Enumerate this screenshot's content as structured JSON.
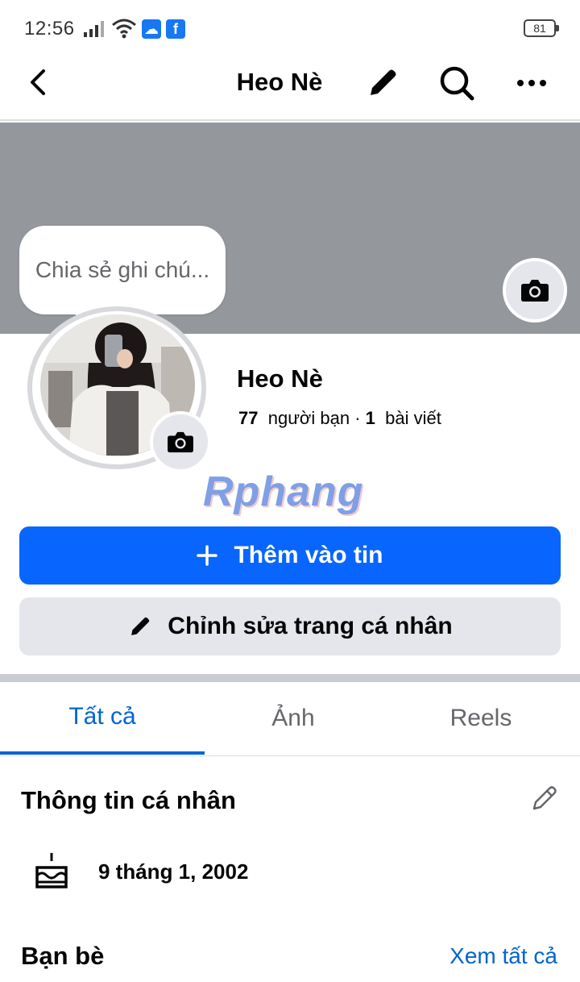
{
  "status_bar": {
    "time": "12:56",
    "battery": "81",
    "icons": [
      "signal-icon",
      "wifi-icon",
      "weather-app-icon",
      "facebook-app-icon"
    ]
  },
  "header": {
    "title": "Heo Nè",
    "icons": [
      "back-arrow-icon",
      "pencil-icon",
      "search-icon",
      "more-dots-icon"
    ]
  },
  "note": {
    "placeholder": "Chia sẻ ghi chú..."
  },
  "profile": {
    "name": "Heo Nè",
    "friends_count": "77",
    "friends_label": "người bạn",
    "separator": "·",
    "posts_count": "1",
    "posts_label": "bài viết"
  },
  "watermark": "Rphang",
  "actions": {
    "add_story": "Thêm vào tin",
    "edit_profile": "Chỉnh sửa trang cá nhân"
  },
  "tabs": [
    {
      "label": "Tất cả",
      "active": true
    },
    {
      "label": "Ảnh",
      "active": false
    },
    {
      "label": "Reels",
      "active": false
    }
  ],
  "personal_info": {
    "title": "Thông tin cá nhân",
    "birthday": "9 tháng 1, 2002"
  },
  "friends": {
    "title": "Bạn bè",
    "see_all": "Xem tất cả"
  },
  "colors": {
    "primary": "#0866ff",
    "link": "#0064d1",
    "cover": "#94979b",
    "secondary_button": "#e4e6eb"
  }
}
